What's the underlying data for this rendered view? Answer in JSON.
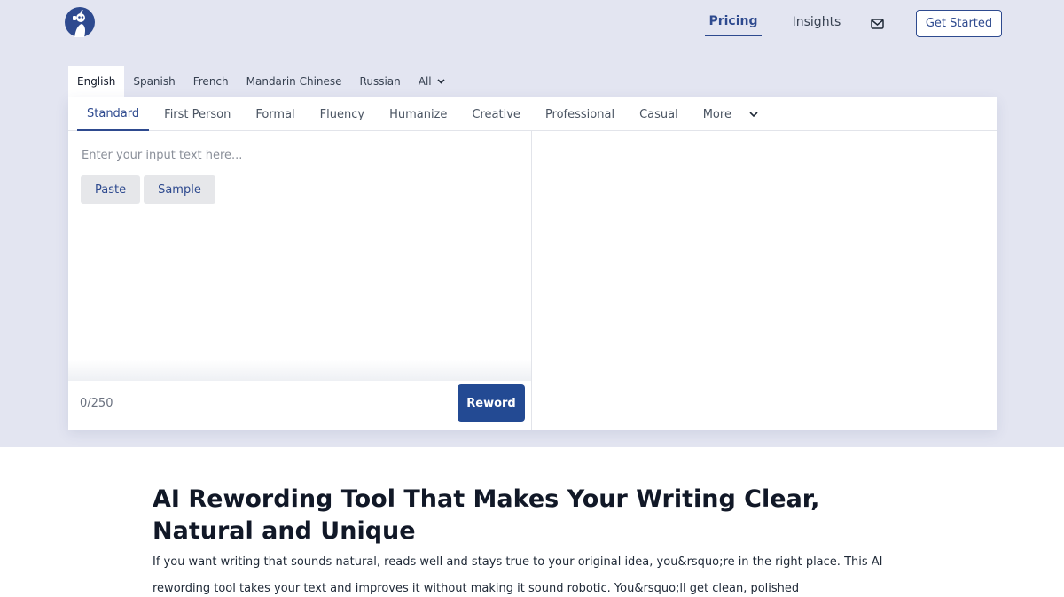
{
  "header": {
    "logo_icon": "robot-bird-logo-icon",
    "nav": {
      "pricing": "Pricing",
      "insights": "Insights",
      "mail_icon": "mail-icon",
      "get_started": "Get Started"
    }
  },
  "languages": {
    "items": [
      "English",
      "Spanish",
      "French",
      "Mandarin Chinese",
      "Russian",
      "All"
    ],
    "active": "English"
  },
  "modes": {
    "items": [
      "Standard",
      "First Person",
      "Formal",
      "Fluency",
      "Humanize",
      "Creative",
      "Professional",
      "Casual",
      "More"
    ],
    "active": "Standard"
  },
  "editor": {
    "input_placeholder": "Enter your input text here...",
    "input_value": "",
    "paste_label": "Paste",
    "sample_label": "Sample",
    "counter": "0/250",
    "reword_label": "Reword"
  },
  "article": {
    "title": "AI Rewording Tool That Makes Your Writing Clear, Natural and Unique",
    "paragraph": "If you want writing that sounds natural, reads well and stays true to your original idea, you&rsquo;re in the right place. This AI rewording tool takes your text and improves it without making it sound robotic. You&rsquo;ll get clean, polished"
  },
  "colors": {
    "accent": "#2e4a8f",
    "button": "#234a93",
    "hero_bg": "#e3e5f1"
  }
}
